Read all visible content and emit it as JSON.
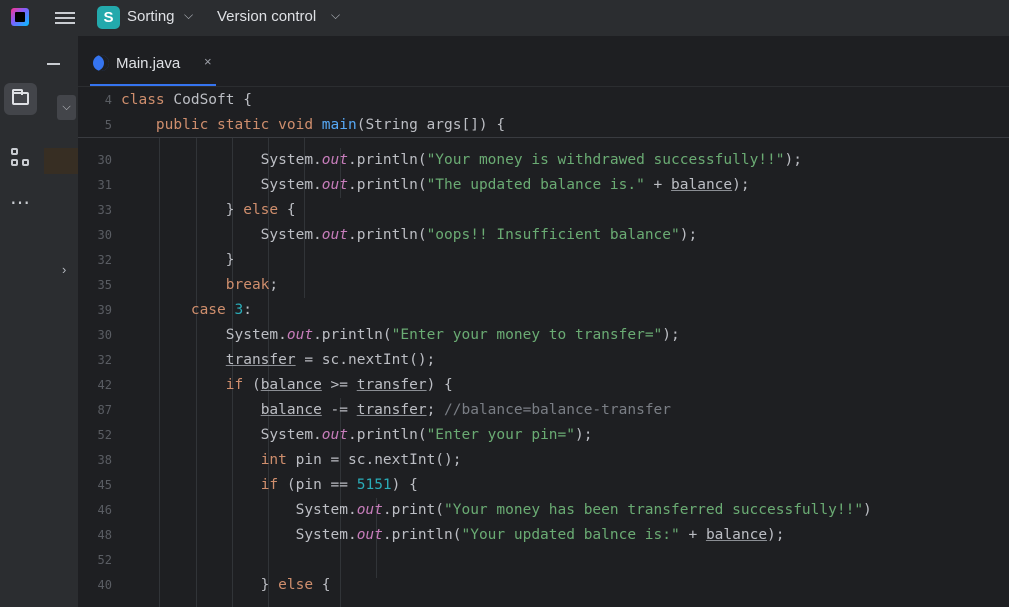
{
  "titlebar": {
    "project_initial": "S",
    "project_name": "Sorting",
    "vcs_label": "Version control",
    "chevron": "⌵"
  },
  "toolstrip": {
    "project_icon": "folder-icon",
    "structure_icon": "structure-icon",
    "more_label": "⋯"
  },
  "panel": {
    "expand_glyph": "⌵",
    "arrow_glyph": "›"
  },
  "tabs": [
    {
      "label": "Main.java",
      "close": "×",
      "icon": "java-class-icon"
    }
  ],
  "sticky_lines": [
    {
      "num": "4",
      "segments": [
        {
          "t": "class ",
          "c": "kw"
        },
        {
          "t": "CodSoft {",
          "c": ""
        }
      ]
    },
    {
      "num": "5",
      "segments": [
        {
          "t": "    public static void ",
          "c": "kw"
        },
        {
          "t": "main",
          "c": "fn"
        },
        {
          "t": "(String args[]) {",
          "c": ""
        }
      ]
    }
  ],
  "lines": [
    {
      "num": "30",
      "segments": [
        {
          "t": "                System.",
          "c": ""
        },
        {
          "t": "out",
          "c": "it"
        },
        {
          "t": ".println(",
          "c": ""
        },
        {
          "t": "\"Your money is withdrawed successfully!!\"",
          "c": "str"
        },
        {
          "t": ");",
          "c": ""
        }
      ]
    },
    {
      "num": "31",
      "segments": [
        {
          "t": "                System.",
          "c": ""
        },
        {
          "t": "out",
          "c": "it"
        },
        {
          "t": ".println(",
          "c": ""
        },
        {
          "t": "\"The updated balance is.\"",
          "c": "str"
        },
        {
          "t": " + ",
          "c": ""
        },
        {
          "t": "balance",
          "c": "ul"
        },
        {
          "t": ");",
          "c": ""
        }
      ]
    },
    {
      "num": "33",
      "segments": [
        {
          "t": "            } ",
          "c": ""
        },
        {
          "t": "else",
          "c": "kw"
        },
        {
          "t": " {",
          "c": ""
        }
      ]
    },
    {
      "num": "30",
      "segments": [
        {
          "t": "                System.",
          "c": ""
        },
        {
          "t": "out",
          "c": "it"
        },
        {
          "t": ".println(",
          "c": ""
        },
        {
          "t": "\"oops!! Insufficient balance\"",
          "c": "str"
        },
        {
          "t": ");",
          "c": ""
        }
      ]
    },
    {
      "num": "32",
      "segments": [
        {
          "t": "            }",
          "c": ""
        }
      ]
    },
    {
      "num": "35",
      "segments": [
        {
          "t": "            ",
          "c": ""
        },
        {
          "t": "break",
          "c": "kw"
        },
        {
          "t": ";",
          "c": ""
        }
      ]
    },
    {
      "num": "39",
      "segments": [
        {
          "t": "        ",
          "c": ""
        },
        {
          "t": "case ",
          "c": "kw"
        },
        {
          "t": "3",
          "c": "num"
        },
        {
          "t": ":",
          "c": ""
        }
      ]
    },
    {
      "num": "30",
      "segments": [
        {
          "t": "            System.",
          "c": ""
        },
        {
          "t": "out",
          "c": "it"
        },
        {
          "t": ".println(",
          "c": ""
        },
        {
          "t": "\"Enter your money to transfer=\"",
          "c": "str"
        },
        {
          "t": ");",
          "c": ""
        }
      ]
    },
    {
      "num": "32",
      "segments": [
        {
          "t": "            ",
          "c": ""
        },
        {
          "t": "transfer",
          "c": "ul"
        },
        {
          "t": " = sc.nextInt();",
          "c": ""
        }
      ]
    },
    {
      "num": "42",
      "segments": [
        {
          "t": "            ",
          "c": ""
        },
        {
          "t": "if",
          "c": "kw"
        },
        {
          "t": " (",
          "c": ""
        },
        {
          "t": "balance",
          "c": "ul"
        },
        {
          "t": " >= ",
          "c": ""
        },
        {
          "t": "transfer",
          "c": "ul"
        },
        {
          "t": ") {",
          "c": ""
        }
      ]
    },
    {
      "num": "87",
      "segments": [
        {
          "t": "                ",
          "c": ""
        },
        {
          "t": "balance",
          "c": "ul"
        },
        {
          "t": " -= ",
          "c": ""
        },
        {
          "t": "transfer",
          "c": "ul"
        },
        {
          "t": "; ",
          "c": ""
        },
        {
          "t": "//balance=balance-transfer",
          "c": "cm"
        }
      ]
    },
    {
      "num": "52",
      "segments": [
        {
          "t": "                System.",
          "c": ""
        },
        {
          "t": "out",
          "c": "it"
        },
        {
          "t": ".println(",
          "c": ""
        },
        {
          "t": "\"Enter your pin=\"",
          "c": "str"
        },
        {
          "t": ");",
          "c": ""
        }
      ]
    },
    {
      "num": "38",
      "segments": [
        {
          "t": "                ",
          "c": ""
        },
        {
          "t": "int",
          "c": "kw"
        },
        {
          "t": " pin = sc.nextInt();",
          "c": ""
        }
      ]
    },
    {
      "num": "45",
      "segments": [
        {
          "t": "                ",
          "c": ""
        },
        {
          "t": "if",
          "c": "kw"
        },
        {
          "t": " (pin == ",
          "c": ""
        },
        {
          "t": "5151",
          "c": "num"
        },
        {
          "t": ") {",
          "c": ""
        }
      ]
    },
    {
      "num": "46",
      "segments": [
        {
          "t": "                    System.",
          "c": ""
        },
        {
          "t": "out",
          "c": "it"
        },
        {
          "t": ".print(",
          "c": ""
        },
        {
          "t": "\"Your money has been transferred successfully!!\"",
          "c": "str"
        },
        {
          "t": ")",
          "c": ""
        }
      ]
    },
    {
      "num": "48",
      "segments": [
        {
          "t": "                    System.",
          "c": ""
        },
        {
          "t": "out",
          "c": "it"
        },
        {
          "t": ".println(",
          "c": ""
        },
        {
          "t": "\"Your updated balnce is:\"",
          "c": "str"
        },
        {
          "t": " + ",
          "c": ""
        },
        {
          "t": "balance",
          "c": "ul"
        },
        {
          "t": ");",
          "c": ""
        }
      ]
    },
    {
      "num": "52",
      "segments": [
        {
          "t": "",
          "c": ""
        }
      ]
    },
    {
      "num": "40",
      "segments": [
        {
          "t": "                } ",
          "c": ""
        },
        {
          "t": "else",
          "c": "kw"
        },
        {
          "t": " {",
          "c": ""
        }
      ]
    }
  ]
}
